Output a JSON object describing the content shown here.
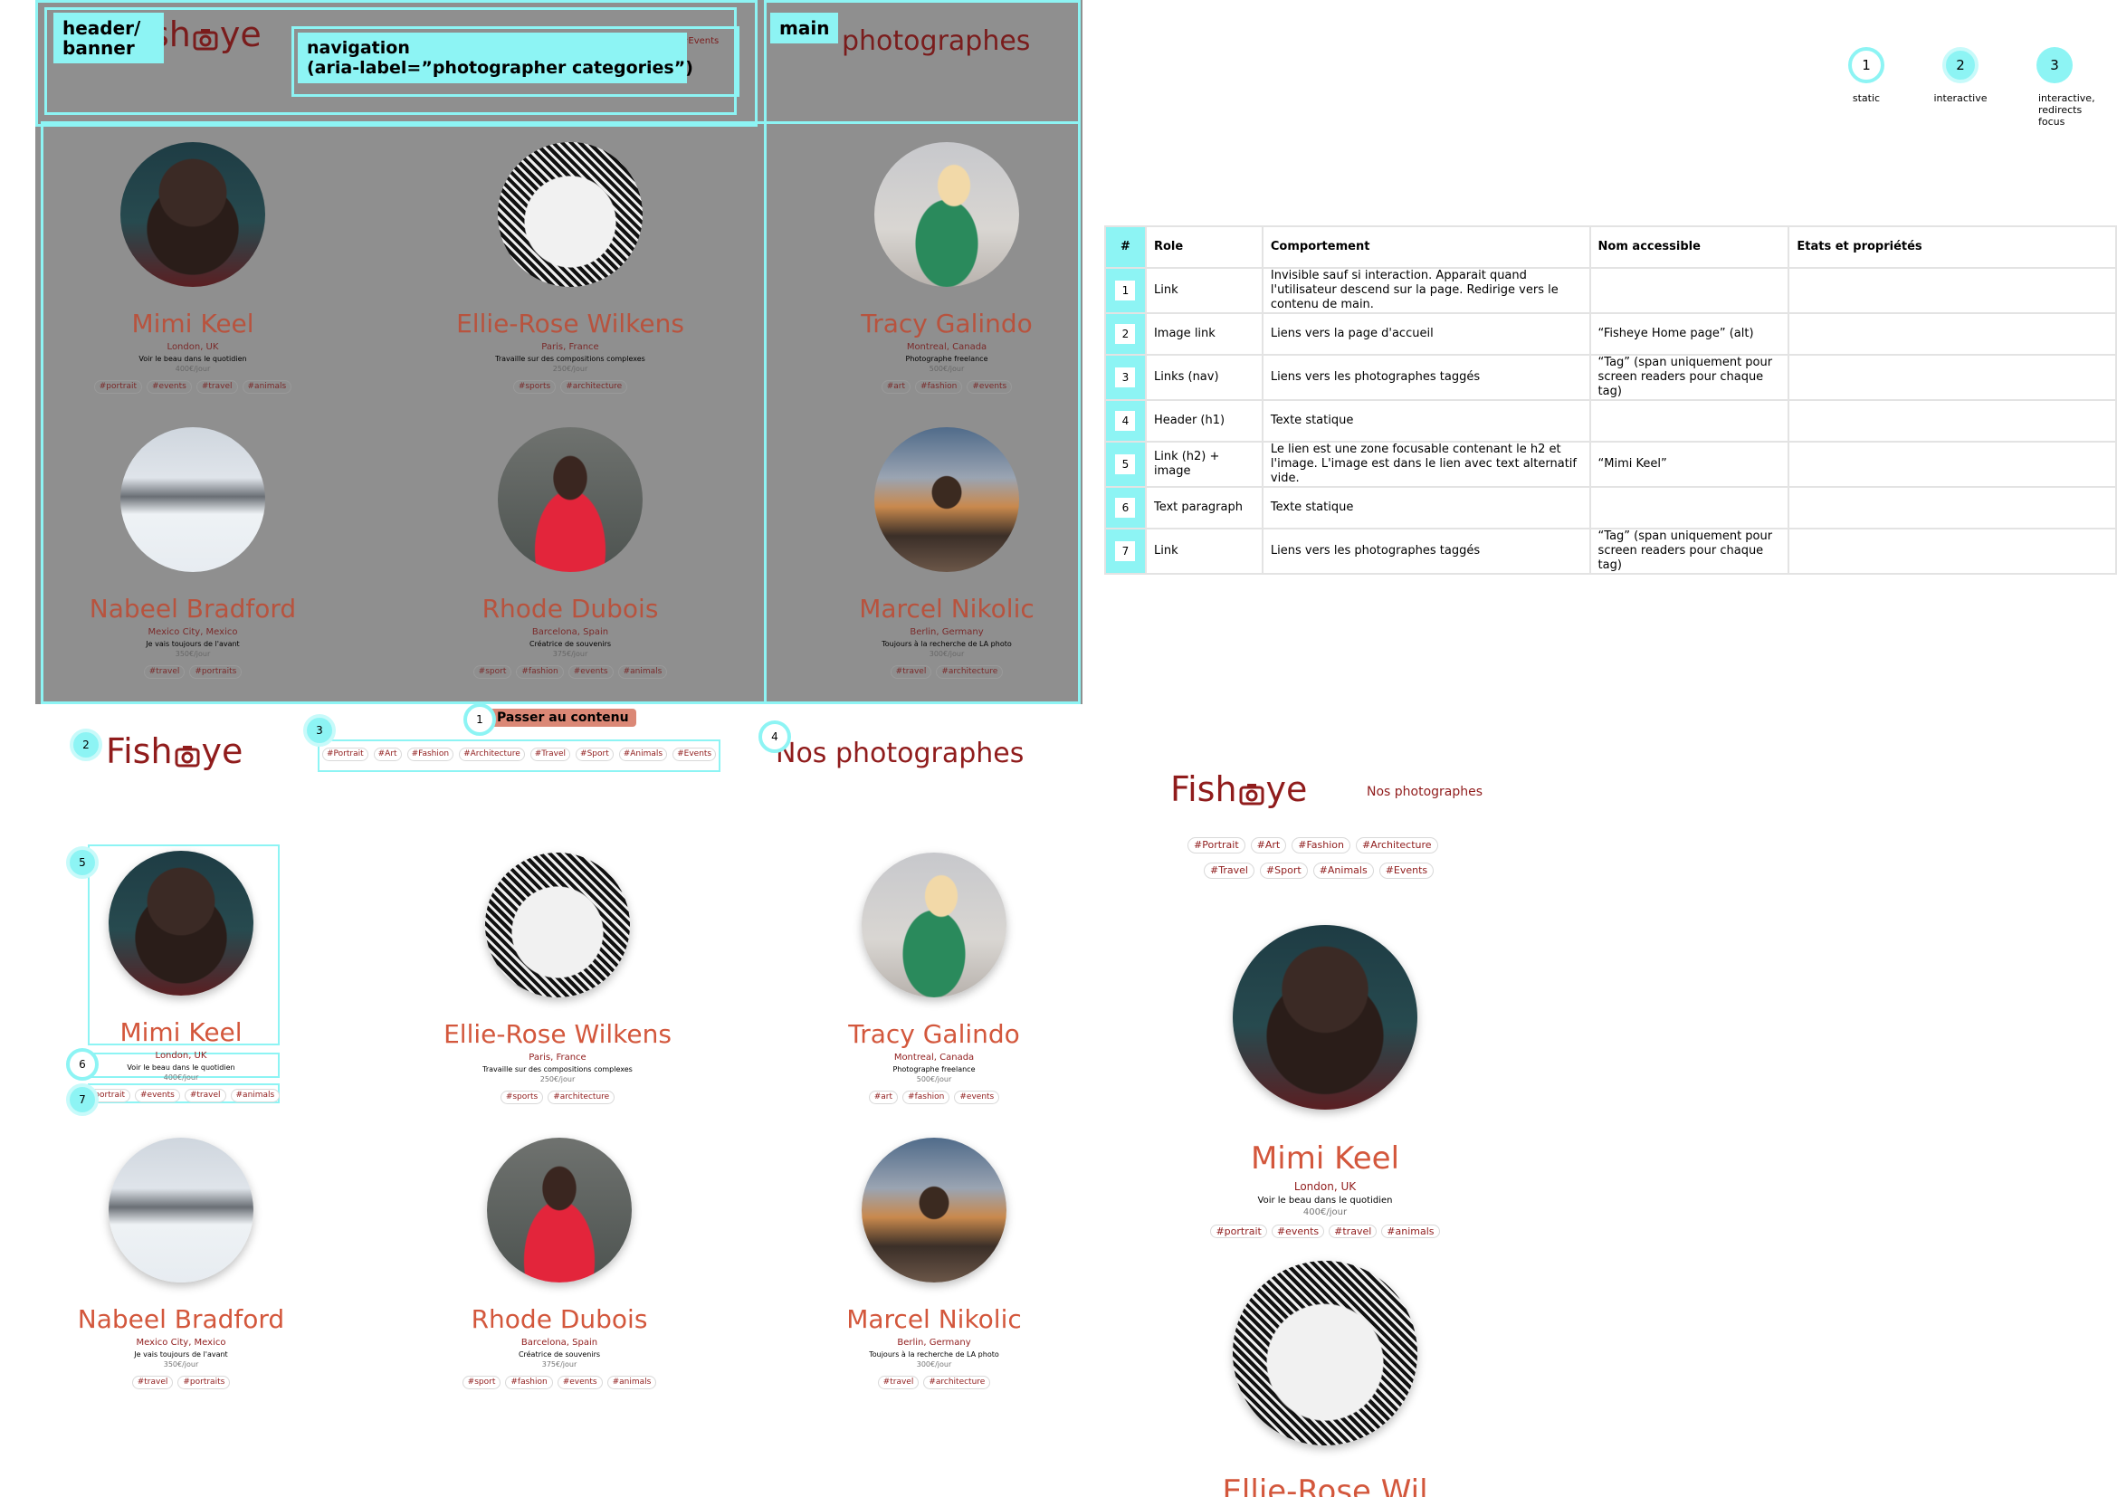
{
  "site": {
    "logo_text_left": "Fish",
    "logo_text_right": "ye",
    "logo_partial_left": "sh",
    "page_title": "Nos photographes",
    "page_title_partial": "photographes",
    "skip_link": "Passer au contenu"
  },
  "landmarks": {
    "header": "header/\nbanner",
    "navigation": "navigation\n(aria-label=”photographer categories”)",
    "main": "main",
    "events_tag": "#Events"
  },
  "nav_tags": [
    "#Portrait",
    "#Art",
    "#Fashion",
    "#Architecture",
    "#Travel",
    "#Sport",
    "#Animals",
    "#Events"
  ],
  "photographers": [
    {
      "name": "Mimi Keel",
      "location": "London, UK",
      "tagline": "Voir le beau dans le quotidien",
      "price": "400€/jour",
      "tags": [
        "#portrait",
        "#events",
        "#travel",
        "#animals"
      ]
    },
    {
      "name": "Ellie-Rose Wilkens",
      "location": "Paris, France",
      "tagline": "Travaille sur des compositions complexes",
      "price": "250€/jour",
      "tags": [
        "#sports",
        "#architecture"
      ]
    },
    {
      "name": "Tracy Galindo",
      "location": "Montreal, Canada",
      "tagline": "Photographe freelance",
      "price": "500€/jour",
      "tags": [
        "#art",
        "#fashion",
        "#events"
      ]
    },
    {
      "name": "Nabeel Bradford",
      "location": "Mexico City, Mexico",
      "tagline": "Je vais toujours de l'avant",
      "price": "350€/jour",
      "tags": [
        "#travel",
        "#portraits"
      ]
    },
    {
      "name": "Rhode Dubois",
      "location": "Barcelona, Spain",
      "tagline": "Créatrice de souvenirs",
      "price": "375€/jour",
      "tags": [
        "#sport",
        "#fashion",
        "#events",
        "#animals"
      ]
    },
    {
      "name": "Marcel Nikolic",
      "location": "Berlin, Germany",
      "tagline": "Toujours à la recherche de LA photo",
      "price": "300€/jour",
      "tags": [
        "#travel",
        "#architecture"
      ]
    }
  ],
  "legend": [
    {
      "num": "1",
      "text": "static"
    },
    {
      "num": "2",
      "text": "interactive"
    },
    {
      "num": "3",
      "text": "interactive,\nredirects\nfocus"
    }
  ],
  "table": {
    "headers": [
      "#",
      "Role",
      "Comportement",
      "Nom accessible",
      "Etats et propriétés"
    ],
    "rows": [
      {
        "num": "1",
        "role": "Link",
        "behaviour": "Invisible sauf si interaction. Apparait quand l'utilisateur descend sur la page. Redirige vers le contenu de main.",
        "name": "",
        "states": ""
      },
      {
        "num": "2",
        "role": "Image link",
        "behaviour": "Liens vers la page d'accueil",
        "name": "“Fisheye Home page” (alt)",
        "states": ""
      },
      {
        "num": "3",
        "role": "Links (nav)",
        "behaviour": "Liens vers les photographes taggés",
        "name": "“Tag” (span uniquement pour screen readers pour chaque tag)",
        "states": ""
      },
      {
        "num": "4",
        "role": "Header (h1)",
        "behaviour": "Texte statique",
        "name": "",
        "states": ""
      },
      {
        "num": "5",
        "role": "Link (h2) + image",
        "behaviour": "Le lien est une zone focusable contenant le h2 et l'image. L'image est dans le lien avec text alternatif vide.",
        "name": "“Mimi Keel”",
        "states": ""
      },
      {
        "num": "6",
        "role": "Text paragraph",
        "behaviour": "Texte statique",
        "name": "",
        "states": ""
      },
      {
        "num": "7",
        "role": "Link",
        "behaviour": "Liens vers les photographes taggés",
        "name": "“Tag” (span uniquement pour screen readers pour chaque tag)",
        "states": ""
      }
    ]
  },
  "annotations": [
    "1",
    "2",
    "3",
    "4",
    "5",
    "6",
    "7"
  ],
  "mobile": {
    "tags_row1": [
      "#Portrait",
      "#Art",
      "#Fashion",
      "#Architecture"
    ],
    "tags_row2": [
      "#Travel",
      "#Sport",
      "#Animals",
      "#Events"
    ],
    "second_name_partial": "Ellie-Rose Wil"
  },
  "colors": {
    "accent_cyan": "#8df4f4",
    "brand_red": "#901c1c",
    "name_orange": "#d3573c",
    "skip_bg": "#db8876"
  }
}
